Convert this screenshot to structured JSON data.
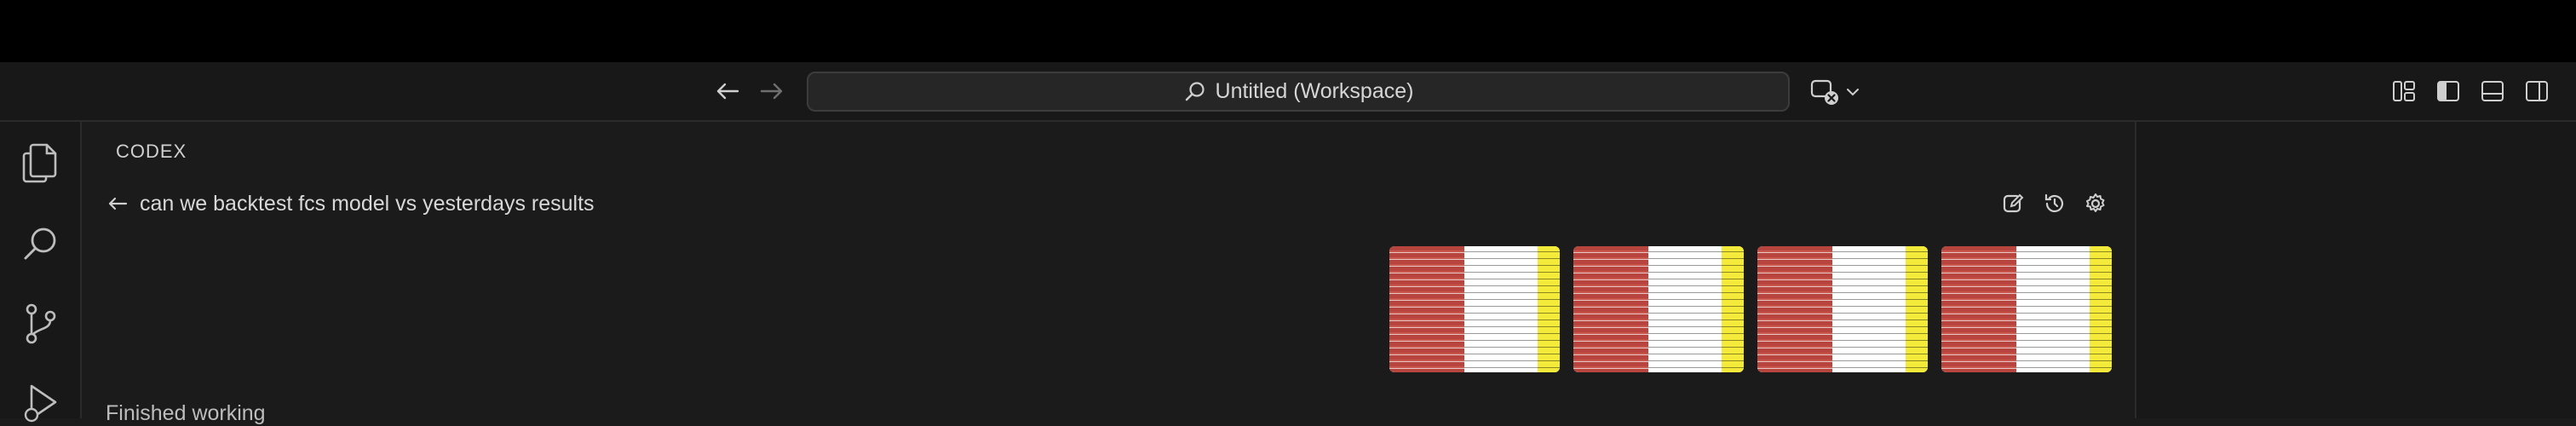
{
  "window": {
    "search_title": "Untitled (Workspace)"
  },
  "activity_bar": {
    "items": [
      "explorer",
      "search",
      "source-control",
      "run-and-debug"
    ]
  },
  "panel": {
    "title": "CODEX",
    "thread_title": "can we backtest fcs model vs yesterdays results",
    "status": "Finished working"
  },
  "attachments": {
    "count": 4
  },
  "icons": {
    "back": "arrow-left-icon",
    "forward": "arrow-right-icon",
    "search": "search-icon",
    "copilot": "copilot-icon",
    "new_chat": "new-chat-icon",
    "history": "history-icon",
    "settings": "gear-icon"
  },
  "colors": {
    "background": "#1b1b1b",
    "titlebar": "#181818",
    "thumb_red": "#b8453d",
    "thumb_yellow": "#f4ea3a"
  }
}
